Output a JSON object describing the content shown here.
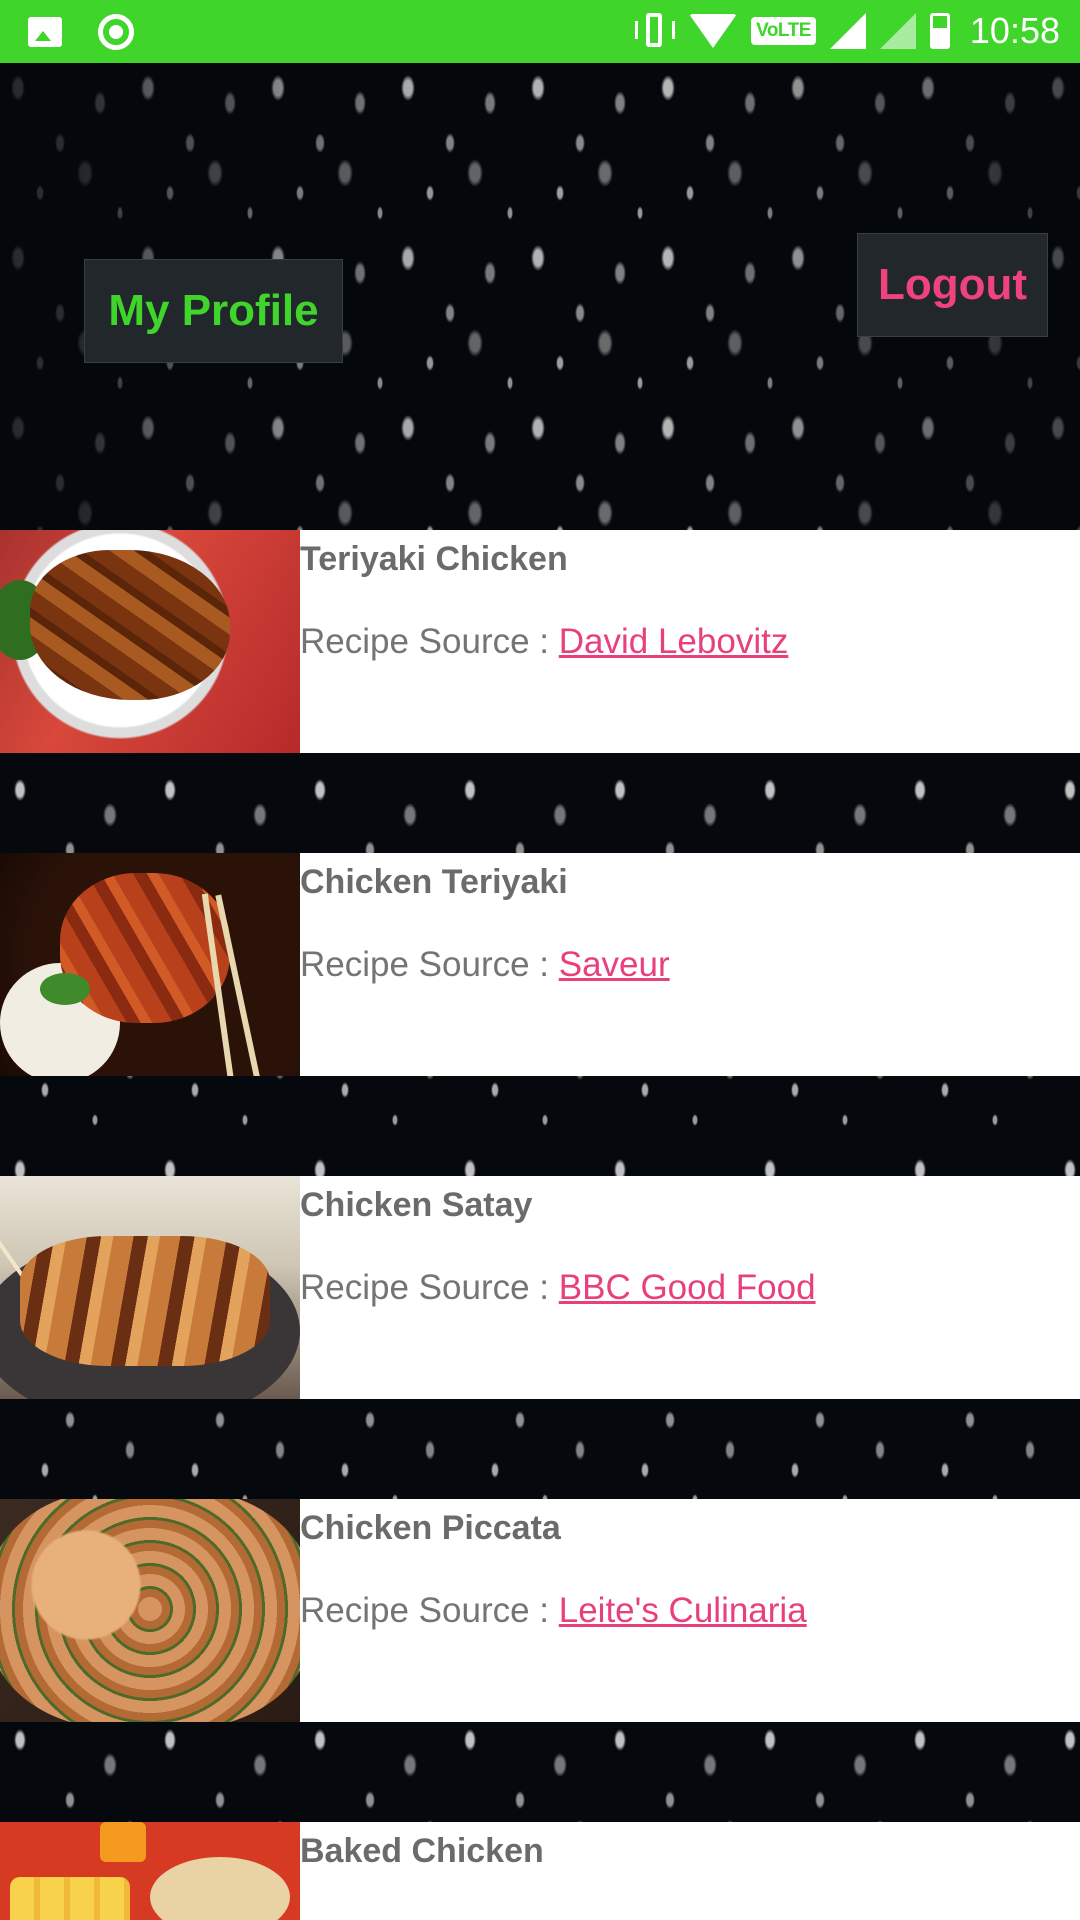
{
  "status_bar": {
    "time": "10:58",
    "network_badge": "VoLTE",
    "icons": [
      "gallery-icon",
      "record-icon",
      "vibrate-icon",
      "wifi-icon",
      "signal-icon",
      "signal-roaming-icon",
      "battery-charging-icon"
    ],
    "background_color": "#3fd52a"
  },
  "header": {
    "profile_label": "My Profile",
    "logout_label": "Logout",
    "profile_color": "#3fd52a",
    "logout_color": "#f0437e"
  },
  "recipes": [
    {
      "title": "Teriyaki Chicken",
      "source_prefix": "Recipe Source : ",
      "source_name": "David Lebovitz"
    },
    {
      "title": "Chicken Teriyaki",
      "source_prefix": "Recipe Source : ",
      "source_name": "Saveur"
    },
    {
      "title": "Chicken Satay",
      "source_prefix": "Recipe Source : ",
      "source_name": "BBC Good Food"
    },
    {
      "title": "Chicken Piccata",
      "source_prefix": "Recipe Source : ",
      "source_name": "Leite's Culinaria"
    },
    {
      "title": "Baked Chicken",
      "source_prefix": "",
      "source_name": ""
    }
  ],
  "colors": {
    "link": "#e8407d",
    "title_text": "#6b6b6b"
  }
}
